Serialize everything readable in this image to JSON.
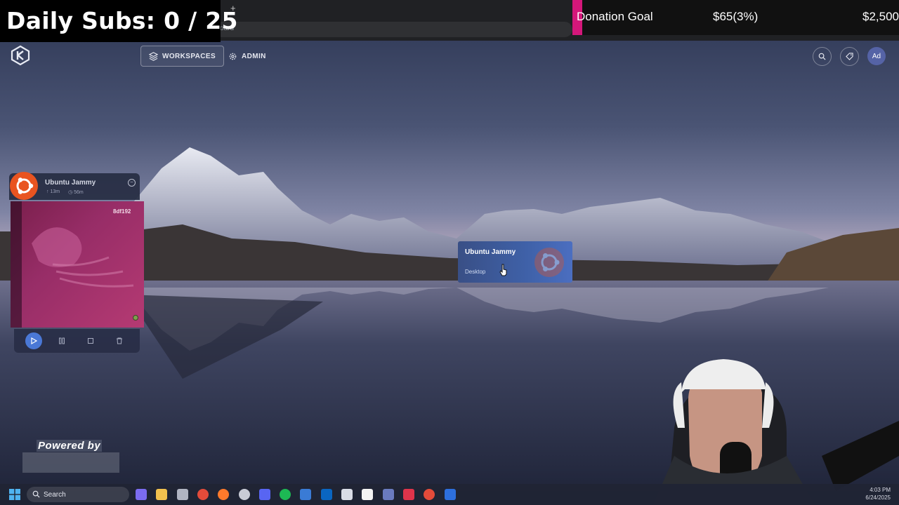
{
  "overlay": {
    "daily_subs": "Daily Subs: 0 / 25",
    "donation_label": "Donation Goal",
    "donation_current": "$65(3%)",
    "donation_target": "$2,500",
    "donation_fraction": 0.026,
    "powered_by": "Powered by"
  },
  "browser": {
    "new_tab": "+",
    "address_partial": "oard"
  },
  "nav": {
    "workspaces": "WORKSPACES",
    "admin": "ADMIN",
    "avatar": "Ad"
  },
  "session": {
    "title": "Ubuntu Jammy",
    "uptime": "13m",
    "remaining": "56m",
    "id": "8df192",
    "close": "−"
  },
  "workspace_card": {
    "title": "Ubuntu Jammy",
    "subtitle": "Desktop"
  },
  "taskbar": {
    "search": "Search",
    "clock_time": "4:03 PM",
    "clock_date": "6/24/2025",
    "icons": [
      "copilot-icon",
      "file-explorer-icon",
      "app-icon",
      "chrome-icon",
      "firefox-icon",
      "chatgpt-icon",
      "discord-icon",
      "spotify-icon",
      "app-icon-2",
      "outlook-icon",
      "mail-icon",
      "notion-icon",
      "app-icon-3",
      "app-icon-4",
      "chrome-icon-2",
      "app-icon-5"
    ]
  },
  "colors": {
    "donation": "#d4177a",
    "accent": "#4a78d6",
    "ubuntu": "#e95420"
  }
}
